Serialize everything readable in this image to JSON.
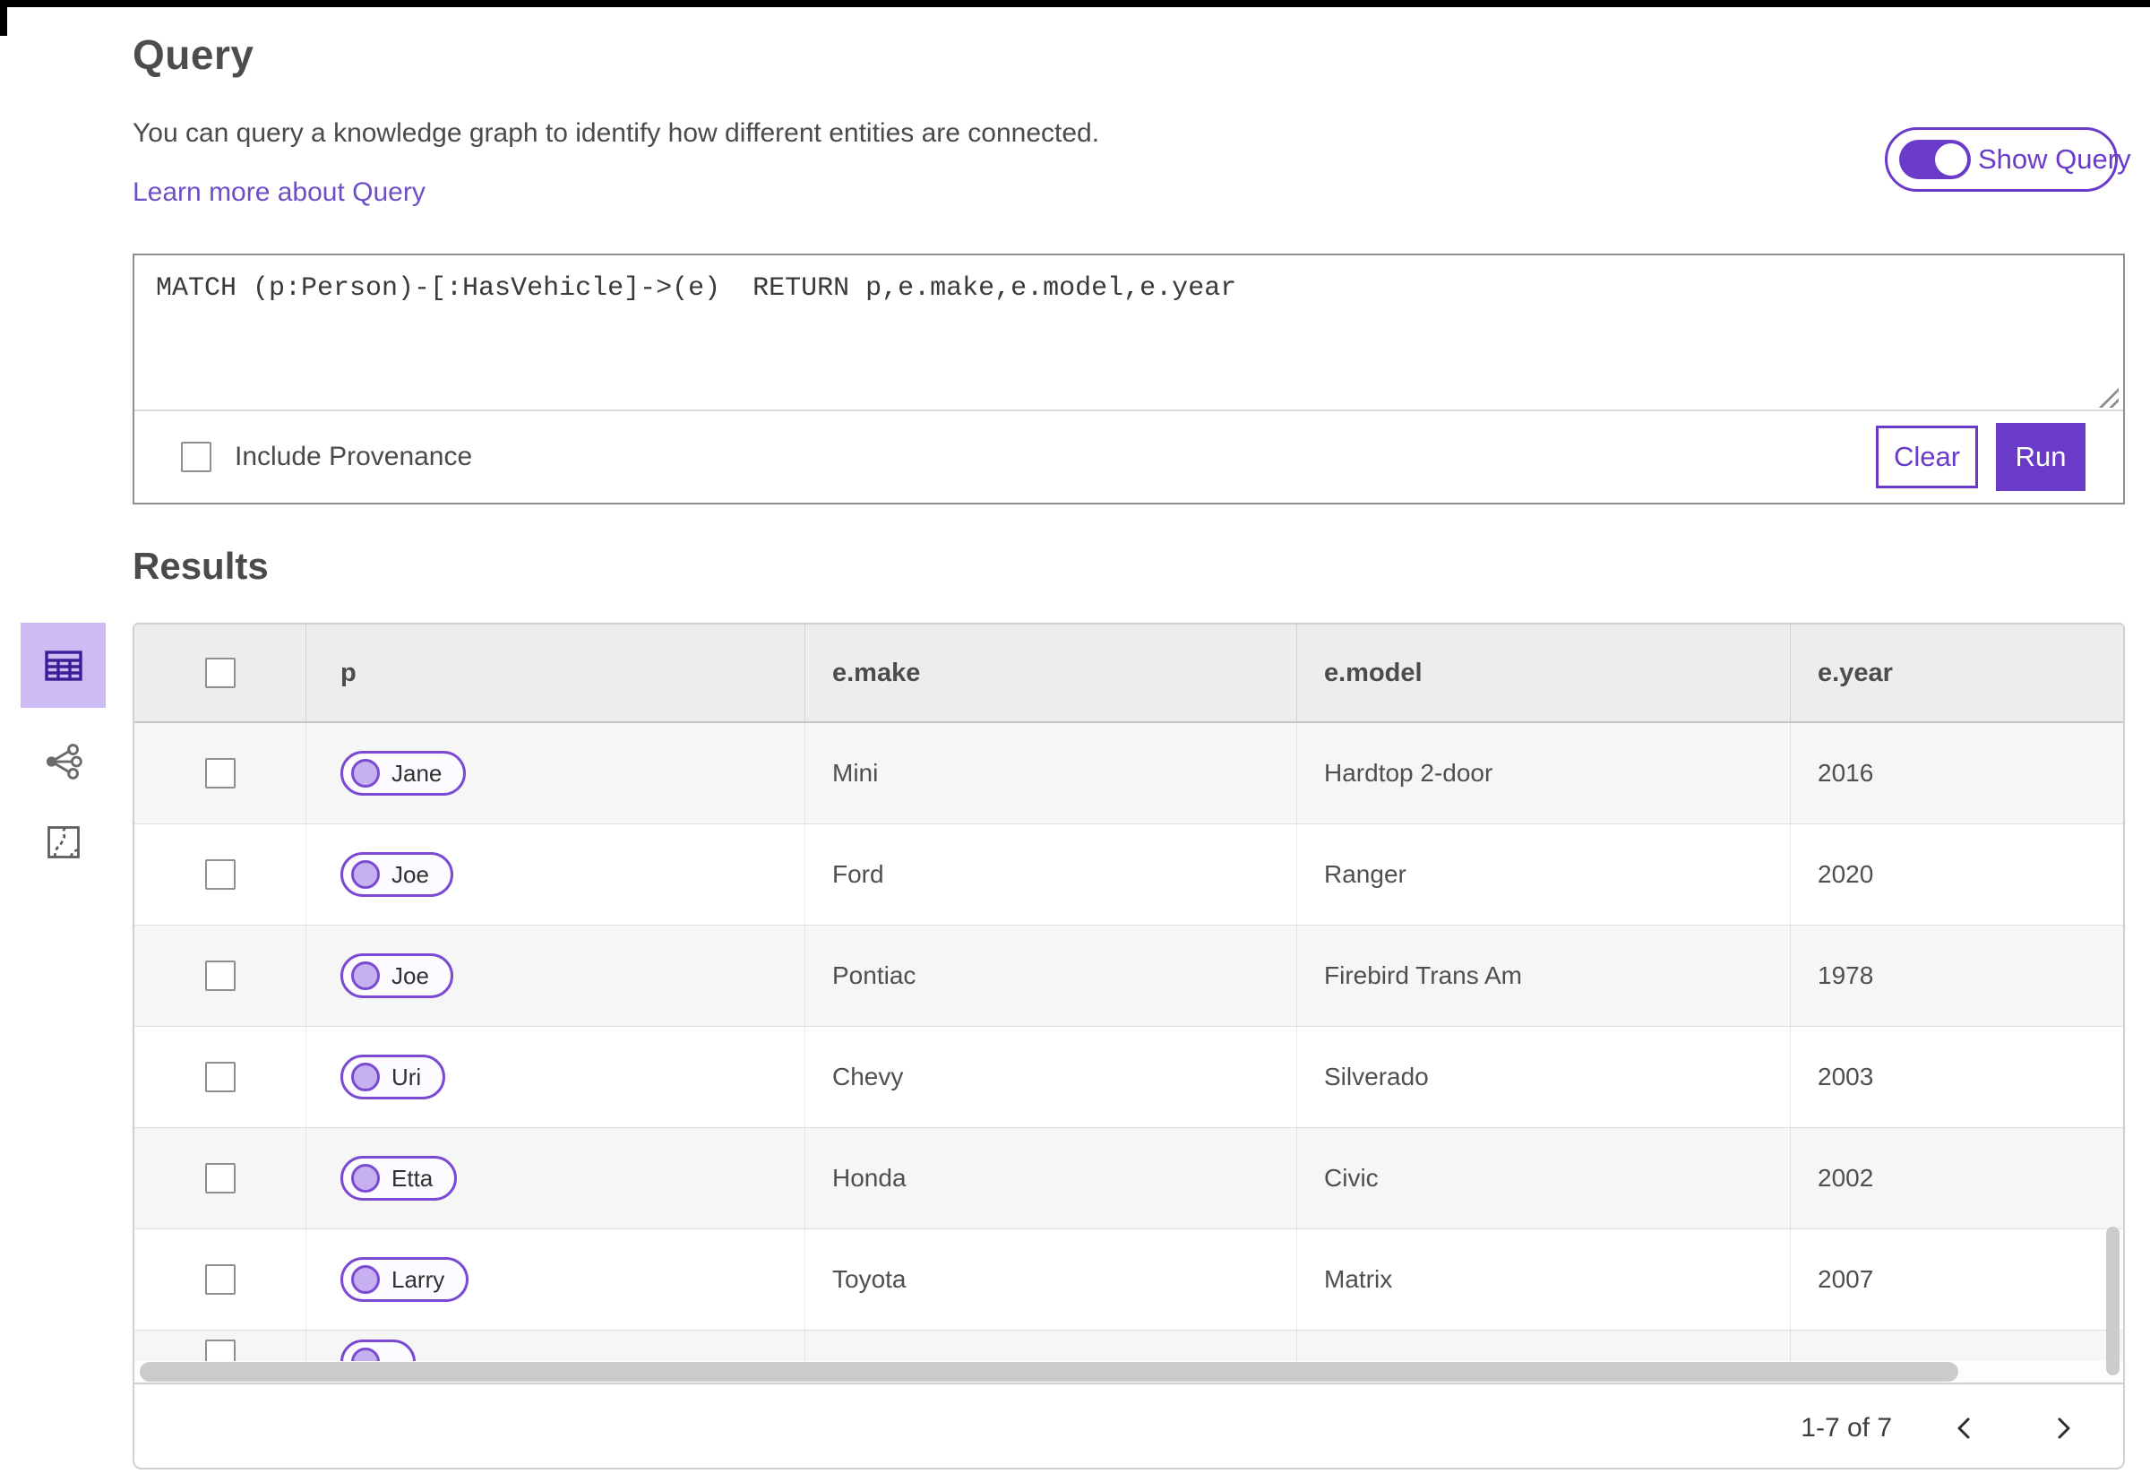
{
  "page": {
    "title": "Query",
    "description": "You can query a knowledge graph to identify how different entities are connected.",
    "learn_more": "Learn more about Query",
    "show_query_label": "Show Query",
    "show_query_state": "on"
  },
  "query_panel": {
    "query_text": "MATCH (p:Person)-[:HasVehicle]->(e)  RETURN p,e.make,e.model,e.year",
    "include_provenance_label": "Include Provenance",
    "include_provenance_checked": false,
    "clear_label": "Clear",
    "run_label": "Run"
  },
  "results": {
    "heading": "Results",
    "view_icons": [
      "table-view-icon",
      "link-chart-view-icon",
      "map-view-icon"
    ],
    "selected_view": "table-view-icon",
    "columns": [
      "p",
      "e.make",
      "e.model",
      "e.year"
    ],
    "rows": [
      {
        "p": "Jane",
        "make": "Mini",
        "model": "Hardtop 2-door",
        "year": "2016"
      },
      {
        "p": "Joe",
        "make": "Ford",
        "model": "Ranger",
        "year": "2020"
      },
      {
        "p": "Joe",
        "make": "Pontiac",
        "model": "Firebird Trans Am",
        "year": "1978"
      },
      {
        "p": "Uri",
        "make": "Chevy",
        "model": "Silverado",
        "year": "2003"
      },
      {
        "p": "Etta",
        "make": "Honda",
        "model": "Civic",
        "year": "2002"
      },
      {
        "p": "Larry",
        "make": "Toyota",
        "model": "Matrix",
        "year": "2007"
      }
    ],
    "pagination": {
      "range_label": "1-7 of 7"
    }
  },
  "colors": {
    "accent_purple": "#6a3ac9",
    "accent_purple_light": "#cdbcf4",
    "pill_border": "#7a4ad2",
    "pill_dot_fill": "#c7b0f0",
    "table_icon_purple": "#3d1c96",
    "header_gray": "#ededed",
    "row_alt_gray": "#f6f6f6",
    "link_purple": "#6e4fc3"
  }
}
